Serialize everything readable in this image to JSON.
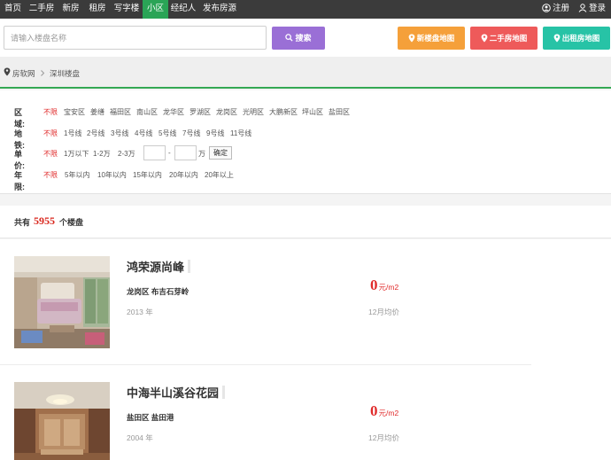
{
  "topnav": {
    "items": [
      "首页",
      "二手房",
      "新房",
      "租房",
      "写字楼",
      "小区",
      "经纪人",
      "发布房源"
    ],
    "active_index": 5,
    "register": "注册",
    "login": "登录"
  },
  "search": {
    "placeholder": "请输入楼盘名称",
    "button": "搜索"
  },
  "map_buttons": [
    {
      "label": "新楼盘地图",
      "color": "#f5a03a"
    },
    {
      "label": "二手房地图",
      "color": "#ee5a5a"
    },
    {
      "label": "出租房地图",
      "color": "#27c3a6"
    }
  ],
  "breadcrumb": [
    "房软网",
    "深圳楼盘"
  ],
  "filters": {
    "region": {
      "label": "区域:",
      "options": [
        "不限",
        "宝安区",
        "姜缮",
        "福田区",
        "南山区",
        "龙华区",
        "罗湖区",
        "龙岗区",
        "光明区",
        "大鹏新区",
        "坪山区",
        "盐田区"
      ]
    },
    "metro": {
      "label": "地铁:",
      "options": [
        "不限",
        "1号线",
        "2号线",
        "3号线",
        "4号线",
        "5号线",
        "7号线",
        "9号线",
        "11号线"
      ]
    },
    "price": {
      "label": "单价:",
      "options": [
        "不限",
        "1万以下",
        "1-2万",
        "2-3万"
      ],
      "dash": "-",
      "unit": "万",
      "confirm": "确定"
    },
    "age": {
      "label": "年限:",
      "options": [
        "不限",
        "5年以内",
        "10年以内",
        "15年以内",
        "20年以内",
        "20年以上"
      ]
    }
  },
  "count": {
    "prefix": "共有",
    "value": "5955",
    "suffix": "个楼盘"
  },
  "listings": [
    {
      "name": "鸿荣源尚峰",
      "address": "龙岗区 布吉石芽岭",
      "year": "2013 年",
      "price": "0",
      "price_unit": "元/m2",
      "price_note": "12月均价"
    },
    {
      "name": "中海半山溪谷花园",
      "address": "盐田区 盐田港",
      "year": "2004 年",
      "price": "0",
      "price_unit": "元/m2",
      "price_note": "12月均价"
    }
  ],
  "colors": {
    "nav_bg": "#3b3b3b",
    "nav_active": "#2aa456",
    "search_btn": "#9a6fd6",
    "accent_red": "#e02b2b",
    "breadcrumb_line": "#34a853"
  }
}
